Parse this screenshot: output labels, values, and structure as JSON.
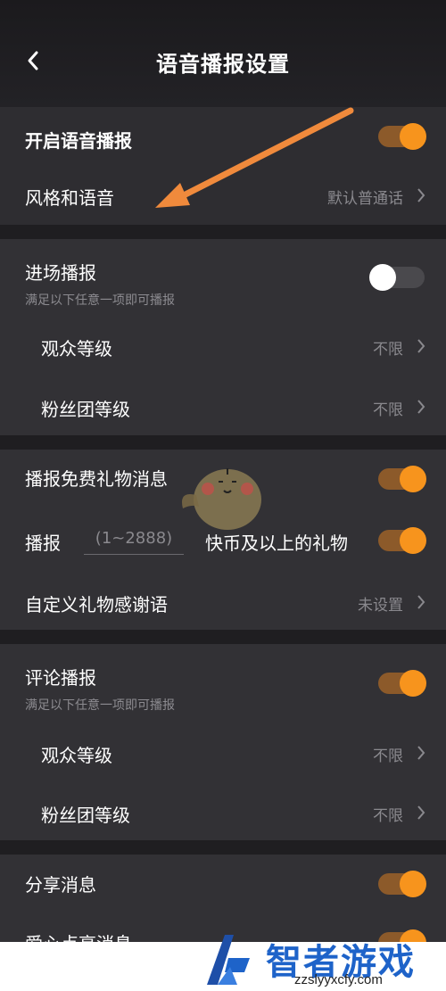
{
  "header": {
    "title": "语音播报设置"
  },
  "section1": {
    "enable_label": "开启语音播报",
    "enable_on": true,
    "style_label": "风格和语音",
    "style_value": "默认普通话"
  },
  "entry": {
    "label": "进场播报",
    "sub": "满足以下任意一项即可播报",
    "on": false,
    "audience_label": "观众等级",
    "audience_value": "不限",
    "fan_label": "粉丝团等级",
    "fan_value": "不限"
  },
  "gift": {
    "free_label": "播报免费礼物消息",
    "free_on": true,
    "broadcast_label": "播报",
    "range_placeholder": "(1~2888)",
    "coin_label": "快币及以上的礼物",
    "coin_on": true,
    "thanks_label": "自定义礼物感谢语",
    "thanks_value": "未设置"
  },
  "comment": {
    "label": "评论播报",
    "sub": "满足以下任意一项即可播报",
    "on": true,
    "audience_label": "观众等级",
    "audience_value": "不限",
    "fan_label": "粉丝团等级",
    "fan_value": "不限"
  },
  "share": {
    "label": "分享消息",
    "on": true,
    "next_label_partial": "爱心点亮消息"
  },
  "watermark": {
    "text": "智者游戏网",
    "url": "zzslyyxcfy.com"
  },
  "colors": {
    "accent": "#f7941d",
    "arrow": "#f08a3c",
    "background": "#2b2a2e"
  },
  "icons": [
    "back-chevron-icon",
    "chevron-right-icon",
    "toggle-switch",
    "mascot-illustration",
    "annotation-arrow"
  ]
}
